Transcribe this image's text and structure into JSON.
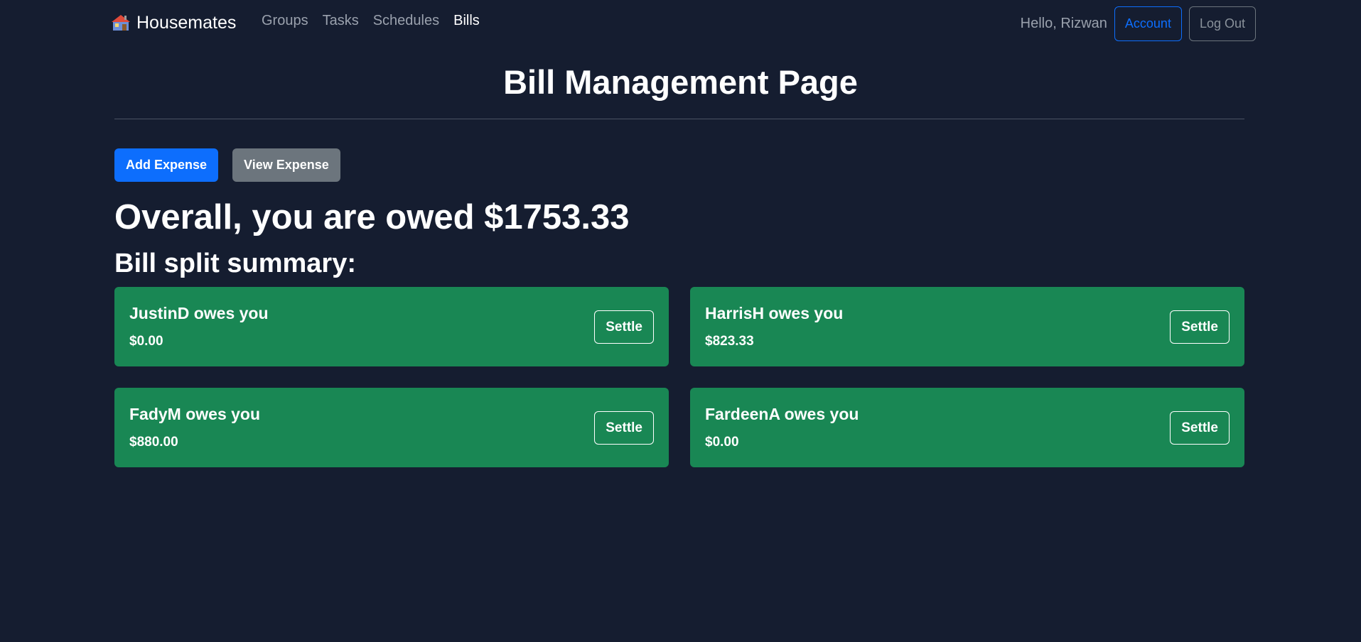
{
  "nav": {
    "brand": "Housemates",
    "brand_icon": "house-icon",
    "links": [
      {
        "label": "Groups"
      },
      {
        "label": "Tasks"
      },
      {
        "label": "Schedules"
      },
      {
        "label": "Bills",
        "active": true
      }
    ],
    "greeting": "Hello, Rizwan",
    "account_label": "Account",
    "logout_label": "Log Out"
  },
  "page": {
    "title": "Bill Management Page",
    "add_expense_label": "Add Expense",
    "view_expense_label": "View Expense",
    "owed_summary": "Overall, you are owed $1753.33",
    "split_heading": "Bill split summary:"
  },
  "balances": [
    {
      "label": "JustinD owes you",
      "amount": "$0.00",
      "settle_label": "Settle"
    },
    {
      "label": "HarrisH owes you",
      "amount": "$823.33",
      "settle_label": "Settle"
    },
    {
      "label": "FadyM owes you",
      "amount": "$880.00",
      "settle_label": "Settle"
    },
    {
      "label": "FardeenA owes you",
      "amount": "$0.00",
      "settle_label": "Settle"
    }
  ],
  "colors": {
    "background": "#151d30",
    "primary": "#0d6efd",
    "secondary": "#6c757d",
    "success": "#198754"
  }
}
